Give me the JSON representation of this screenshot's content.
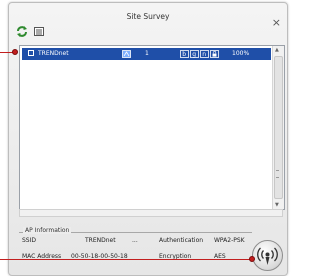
{
  "window": {
    "title": "Site Survey",
    "close_glyph": "×"
  },
  "toolbar": {
    "refresh_icon": "refresh-icon",
    "list_icon": "list-view-icon"
  },
  "network_list": {
    "rows": [
      {
        "ssid": "TRENDnet",
        "channel": "1",
        "signal": "100%",
        "selected": true,
        "status_icons": [
          "network-type-icon",
          "b-mode-icon",
          "g-mode-icon",
          "n-mode-icon",
          "lock-icon"
        ]
      }
    ],
    "highlight_color": "#1f4fa8"
  },
  "ap_info": {
    "title": "AP Information",
    "ssid_label": "SSID",
    "ssid_value": "TRENDnet",
    "ssid_more": "...",
    "auth_label": "Authentication",
    "auth_value": "WPA2-PSK",
    "mac_label": "MAC Address",
    "mac_value": "00-50-18-00-50-18",
    "enc_label": "Encryption",
    "enc_value": "AES"
  },
  "connect_button": {
    "icon": "wireless-connect-icon"
  },
  "callouts": {
    "color": "#c21f1f"
  }
}
